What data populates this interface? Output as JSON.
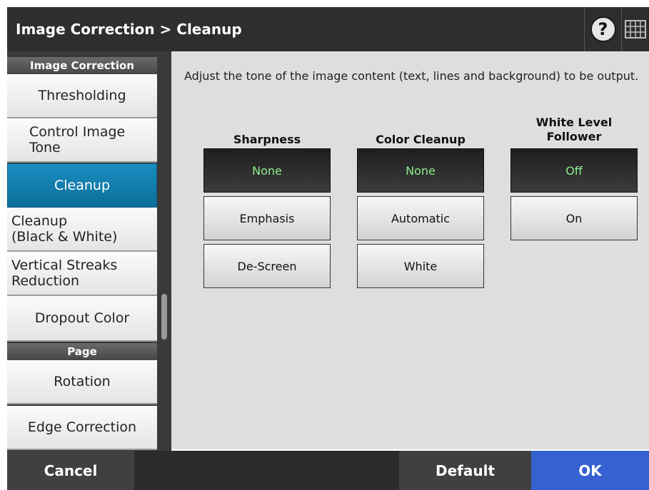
{
  "header": {
    "title": "Image Correction > Cleanup",
    "help_label": "?",
    "help_icon": "help-icon",
    "keyboard_icon": "keyboard-icon"
  },
  "sidebar": {
    "group1": "Image Correction",
    "items1": [
      "Thresholding",
      "Control Image\nTone",
      "Cleanup",
      "Cleanup\n(Black & White)",
      "Vertical Streaks\nReduction",
      "Dropout Color"
    ],
    "active_item": "Cleanup",
    "group2": "Page",
    "items2": [
      "Rotation",
      "Edge Correction"
    ]
  },
  "content": {
    "description": "Adjust the tone of the image content (text, lines and background) to be output.",
    "columns": [
      {
        "header": "Sharpness",
        "options": [
          "None",
          "Emphasis",
          "De-Screen"
        ],
        "selected": "None"
      },
      {
        "header": "Color Cleanup",
        "options": [
          "None",
          "Automatic",
          "White"
        ],
        "selected": "None"
      },
      {
        "header": "White Level\nFollower",
        "options": [
          "Off",
          "On"
        ],
        "selected": "Off"
      }
    ]
  },
  "footer": {
    "cancel_label": "Cancel",
    "default_label": "Default",
    "ok_label": "OK"
  },
  "colors": {
    "accent_blue": "#3561d1",
    "selected_sidebar": "#0b6e99",
    "selected_text_green": "#8dee8d",
    "header_bg": "#2e2e2e"
  }
}
